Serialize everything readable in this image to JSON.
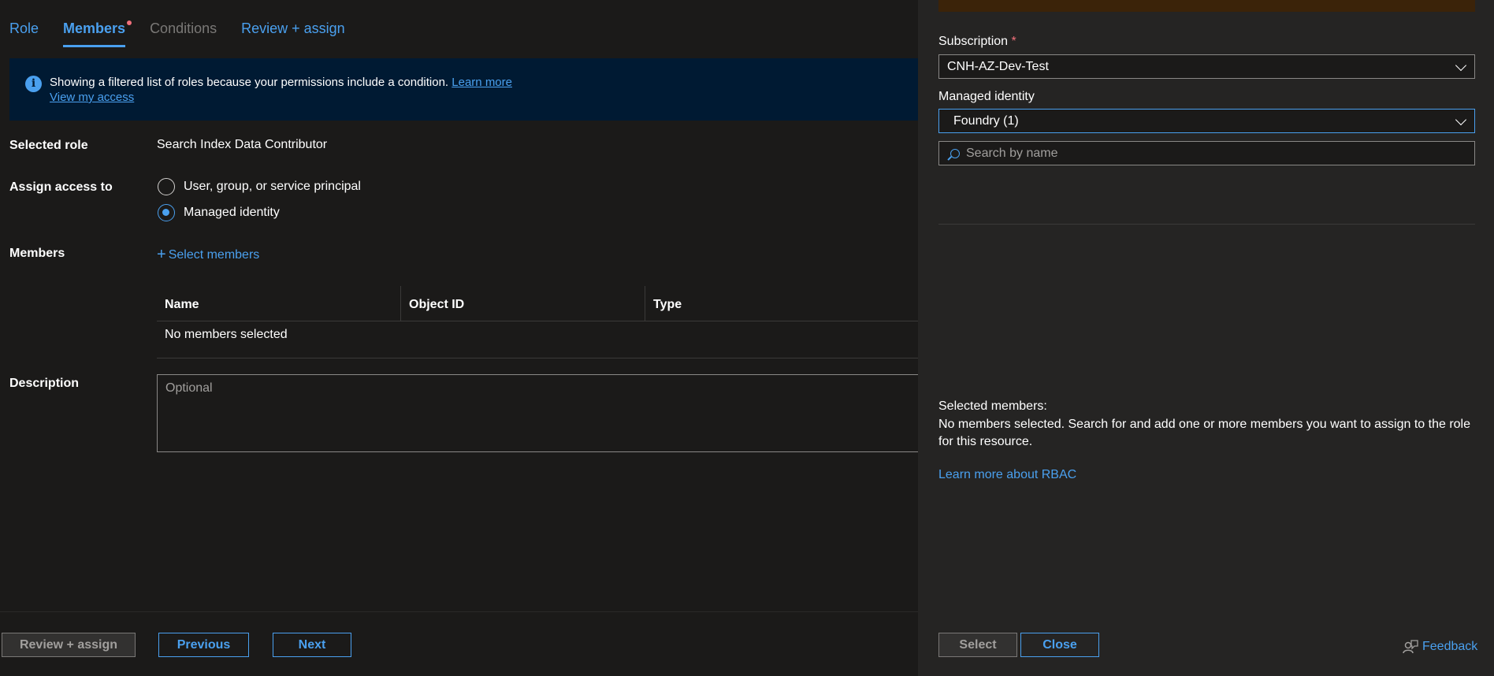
{
  "tabs": [
    {
      "label": "Role",
      "state": "normal"
    },
    {
      "label": "Members",
      "state": "active"
    },
    {
      "label": "Conditions",
      "state": "disabled"
    },
    {
      "label": "Review + assign",
      "state": "normal"
    }
  ],
  "banner": {
    "message": "Showing a filtered list of roles because your permissions include a condition.",
    "learn_more": "Learn more",
    "view_access": "View my access",
    "icon": "info-icon"
  },
  "form": {
    "selected_role_label": "Selected role",
    "selected_role_value": "Search Index Data Contributor",
    "assign_access_label": "Assign access to",
    "option_user": "User, group, or service principal",
    "option_managed": "Managed identity",
    "members_label": "Members",
    "select_members": "Select members",
    "table_headers": [
      "Name",
      "Object ID",
      "Type"
    ],
    "table_empty": "No members selected",
    "description_label": "Description",
    "description_placeholder": "Optional"
  },
  "footer": {
    "review_assign": "Review + assign",
    "previous": "Previous",
    "next": "Next"
  },
  "panel": {
    "subscription_label": "Subscription",
    "required_marker": "*",
    "subscription_value": "CNH-AZ-Dev-Test",
    "managed_identity_label": "Managed identity",
    "managed_identity_value": "Foundry (1)",
    "search_placeholder": "Search by name",
    "selected_members_title": "Selected members:",
    "selected_members_msg": "No members selected. Search for and add one or more members you want to assign to the role for this resource.",
    "learn_rbac": "Learn more about RBAC",
    "select_button": "Select",
    "close_button": "Close",
    "feedback": "Feedback"
  },
  "colors": {
    "accent": "#4aa0ef",
    "background": "#1b1a19",
    "panel": "#252423",
    "required": "#f1707b"
  }
}
